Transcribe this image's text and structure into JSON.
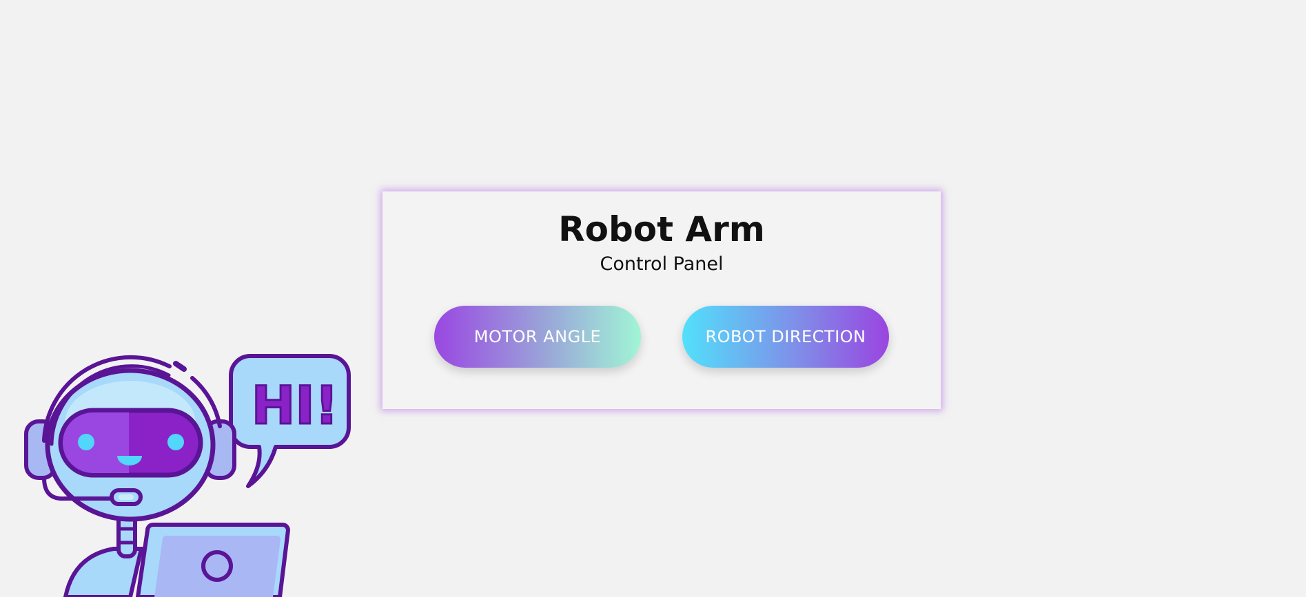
{
  "card": {
    "title": "Robot Arm",
    "subtitle": "Control Panel",
    "buttons": {
      "motor_angle": "MOTOR ANGLE",
      "robot_direction": "ROBOT DIRECTION"
    }
  },
  "illustration": {
    "speech_bubble_text": "HI!",
    "icon": "robot-mascot-with-laptop-icon"
  },
  "colors": {
    "background": "#f2f2f2",
    "card_glow": "#b46ee6",
    "robot_outline": "#5a1496",
    "robot_face": "#9a47e2",
    "robot_body": "#a8d8fa",
    "accent_cyan": "#52e0fb",
    "accent_mint": "#a0f5d6"
  }
}
